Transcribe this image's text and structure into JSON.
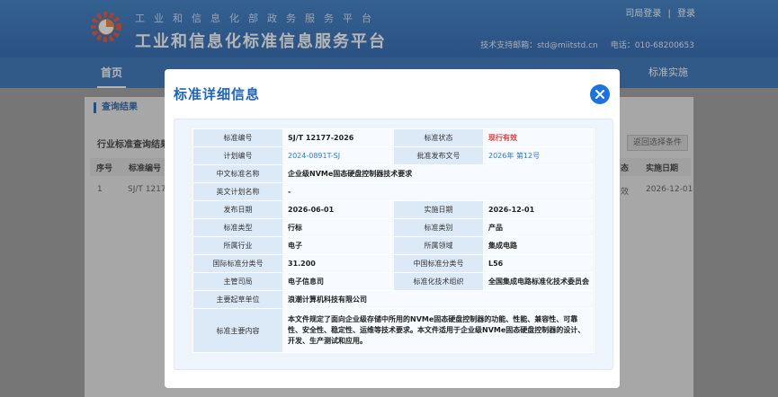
{
  "header": {
    "org_line": "工业和信息化部政务服务平台",
    "site_title": "工业和信息化标准信息服务平台",
    "login_label": "司局登录",
    "divider": "|",
    "register_label": "登录",
    "support_email": "技术支持邮箱：std@miitstd.cn",
    "phone": "电话：010-68200653"
  },
  "nav": {
    "home": "首页",
    "right_item": "标准实施"
  },
  "background": {
    "panel_title": "查询结果",
    "result_title": "行业标准查询结果",
    "return_button": "返回选择条件",
    "columns": [
      "序号",
      "标准编号",
      "态",
      "实施日期"
    ],
    "row": {
      "index": "1",
      "code": "SJ/T 1217",
      "status_fragment": "效",
      "impl_date": "2026-12-01"
    }
  },
  "modal": {
    "title": "标准详细信息",
    "fields": {
      "std_code_label": "标准编号",
      "std_code": "SJ/T 12177-2026",
      "status_label": "标准状态",
      "status": "现行有效",
      "plan_no_label": "计划编号",
      "plan_no": "2024-0891T-SJ",
      "approval_label": "批准发布文号",
      "approval": "2026年 第12号",
      "cn_name_label": "中文标准名称",
      "cn_name": "企业级NVMe固态硬盘控制器技术要求",
      "en_name_label": "英文计划名称",
      "en_name": "-",
      "pub_date_label": "发布日期",
      "pub_date": "2026-06-01",
      "impl_date_label": "实施日期",
      "impl_date": "2026-12-01",
      "std_type_label": "标准类型",
      "std_type": "行标",
      "std_class_label": "标准类别",
      "std_class": "产品",
      "industry_label": "所属行业",
      "industry": "电子",
      "field_label": "所属领域",
      "field": "集成电路",
      "ics_label": "国际标准分类号",
      "ics": "31.200",
      "ccs_label": "中国标准分类号",
      "ccs": "L56",
      "dept_label": "主管司局",
      "dept": "电子信息司",
      "tc_label": "标准化技术组织",
      "tc": "全国集成电路标准化技术委员会",
      "drafter_label": "主要起草单位",
      "drafter": "浪潮计算机科技有限公司",
      "summary_label": "标准主要内容",
      "summary": "本文件规定了面向企业级存储中所用的NVMe固态硬盘控制器的功能、性能、兼容性、可靠性、安全性、稳定性、运维等技术要求。本文件适用于企业级NVMe固态硬盘控制器的设计、开发、生产测试和应用。"
    }
  },
  "icons": {
    "logo": "gear-logo-icon",
    "close": "close-icon"
  },
  "colors": {
    "brand_blue": "#1f5fae",
    "accent": "#1a73e0",
    "status_red": "#e33c3c"
  }
}
